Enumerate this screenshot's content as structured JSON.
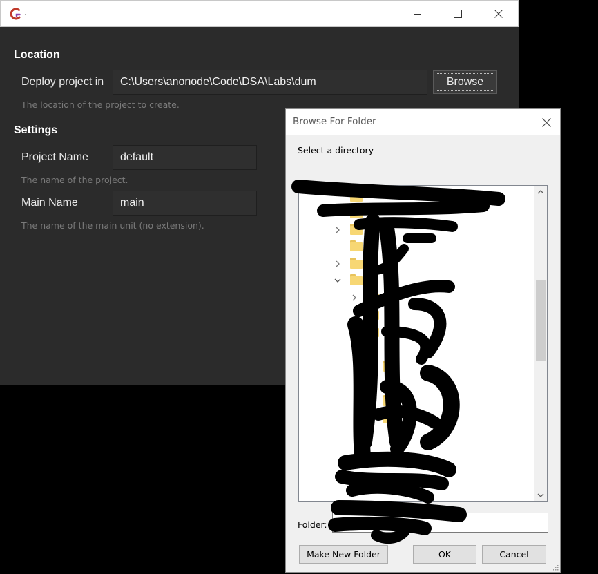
{
  "main_window": {
    "title": ".",
    "accent": "#c0392b",
    "location": {
      "heading": "Location",
      "deploy_label": "Deploy project in",
      "deploy_value": "C:\\Users\\anonode\\Code\\DSA\\Labs\\dum",
      "browse_label": "Browse",
      "hint": "The location of the project to create."
    },
    "settings": {
      "heading": "Settings",
      "project_name_label": "Project Name",
      "project_name_value": "default",
      "project_name_hint": "The name of the project.",
      "main_name_label": "Main Name",
      "main_name_value": "main",
      "main_name_hint": "The name of the main unit (no extension)."
    }
  },
  "dialog": {
    "title": "Browse For Folder",
    "instruction": "Select a directory",
    "tree_icons": [
      "chevron-right-icon",
      "chevron-down-icon",
      "folder-icon"
    ],
    "folder_label": "Folder:",
    "folder_value": "",
    "buttons": {
      "make_new_folder": "Make New Folder",
      "ok": "OK",
      "cancel": "Cancel"
    }
  }
}
